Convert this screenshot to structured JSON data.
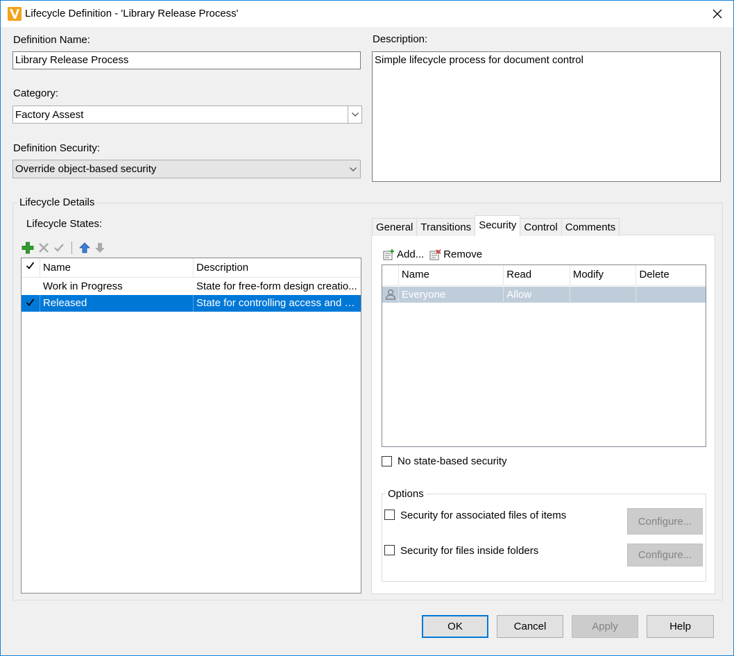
{
  "window": {
    "title": "Lifecycle Definition - 'Library Release Process'",
    "accent": "#0078d7"
  },
  "definition": {
    "name_label": "Definition Name:",
    "name_value": "Library Release Process",
    "category_label": "Category:",
    "category_value": "Factory Assest",
    "security_label": "Definition Security:",
    "security_value": "Override object-based security",
    "description_label": "Description:",
    "description_value": "Simple lifecycle process for document control"
  },
  "lifecycle": {
    "group_title": "Lifecycle Details",
    "states_label": "Lifecycle States:",
    "toolbar_icons": [
      "add-icon",
      "delete-icon",
      "check-icon",
      "move-up-icon",
      "move-down-icon"
    ],
    "columns": [
      "Name",
      "Description"
    ],
    "rows": [
      {
        "checked": false,
        "name": "Work in Progress",
        "description": "State for free-form design creatio..."
      },
      {
        "checked": true,
        "name": "Released",
        "description": "State for controlling access and m..."
      }
    ]
  },
  "tabs": [
    "General",
    "Transitions",
    "Security",
    "Control",
    "Comments"
  ],
  "active_tab": "Security",
  "security": {
    "add_label": "Add...",
    "remove_label": "Remove",
    "columns": [
      "Name",
      "Read",
      "Modify",
      "Delete"
    ],
    "rows": [
      {
        "icon": "user-icon",
        "name": "Everyone",
        "read": "Allow",
        "modify": "",
        "delete": ""
      }
    ],
    "no_state_label": "No state-based security",
    "options_title": "Options",
    "option1_label": "Security for associated files of items",
    "option2_label": "Security for files inside folders",
    "configure_label": "Configure..."
  },
  "buttons": {
    "ok": "OK",
    "cancel": "Cancel",
    "apply": "Apply",
    "help": "Help"
  }
}
